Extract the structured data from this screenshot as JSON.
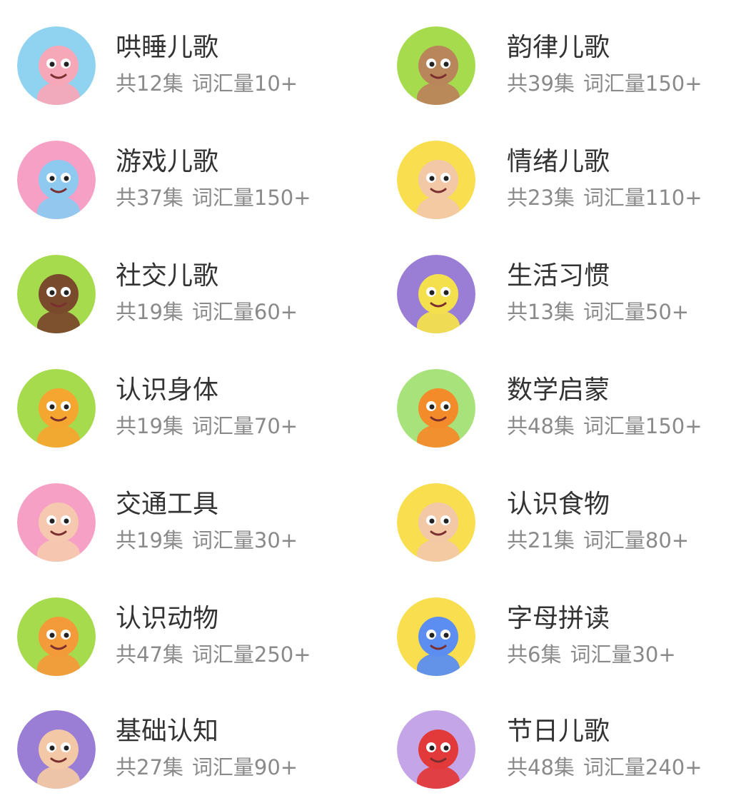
{
  "songs": [
    {
      "title": "哄睡儿歌",
      "episodes": "共12集",
      "vocab": "词汇量10+",
      "icon": "cat-violin-icon",
      "bg": "#8fd3f0",
      "accent": "#f6a8b8"
    },
    {
      "title": "韵律儿歌",
      "episodes": "共39集",
      "vocab": "词汇量150+",
      "icon": "ostrich-icon",
      "bg": "#a7db4e",
      "accent": "#b9855a"
    },
    {
      "title": "游戏儿歌",
      "episodes": "共37集",
      "vocab": "词汇量150+",
      "icon": "elephant-icon",
      "bg": "#f7a0c6",
      "accent": "#8ec9f0"
    },
    {
      "title": "情绪儿歌",
      "episodes": "共23集",
      "vocab": "词汇量110+",
      "icon": "boy-icon",
      "bg": "#f9de4f",
      "accent": "#f2c8a6"
    },
    {
      "title": "社交儿歌",
      "episodes": "共19集",
      "vocab": "词汇量60+",
      "icon": "waving-kid-icon",
      "bg": "#a7db4e",
      "accent": "#7a4a2c"
    },
    {
      "title": "生活习惯",
      "episodes": "共13集",
      "vocab": "词汇量50+",
      "icon": "monster-icon",
      "bg": "#9a7ed6",
      "accent": "#f4e04d"
    },
    {
      "title": "认识身体",
      "episodes": "共19集",
      "vocab": "词汇量70+",
      "icon": "fox-icon",
      "bg": "#a7db4e",
      "accent": "#f4a630"
    },
    {
      "title": "数学启蒙",
      "episodes": "共48集",
      "vocab": "词汇量150+",
      "icon": "numbers-kid-icon",
      "bg": "#a7e27a",
      "accent": "#f38b2a"
    },
    {
      "title": "交通工具",
      "episodes": "共19集",
      "vocab": "词汇量30+",
      "icon": "bike-girl-icon",
      "bg": "#f7a0c6",
      "accent": "#f6c8b0"
    },
    {
      "title": "认识食物",
      "episodes": "共21集",
      "vocab": "词汇量80+",
      "icon": "girl-icecream-icon",
      "bg": "#f9de4f",
      "accent": "#f2c8a6"
    },
    {
      "title": "认识动物",
      "episodes": "共47集",
      "vocab": "词汇量250+",
      "icon": "dinosaur-icon",
      "bg": "#a7db4e",
      "accent": "#f39a3a"
    },
    {
      "title": "字母拼读",
      "episodes": "共6集",
      "vocab": "词汇量30+",
      "icon": "letter-b-icon",
      "bg": "#f9de4f",
      "accent": "#5b8ef0"
    },
    {
      "title": "基础认知",
      "episodes": "共27集",
      "vocab": "词汇量90+",
      "icon": "hooded-kid-icon",
      "bg": "#9a7ed6",
      "accent": "#f2c8a6"
    },
    {
      "title": "节日儿歌",
      "episodes": "共48集",
      "vocab": "词汇量240+",
      "icon": "santa-icon",
      "bg": "#c4a6e8",
      "accent": "#e23a3a"
    }
  ]
}
